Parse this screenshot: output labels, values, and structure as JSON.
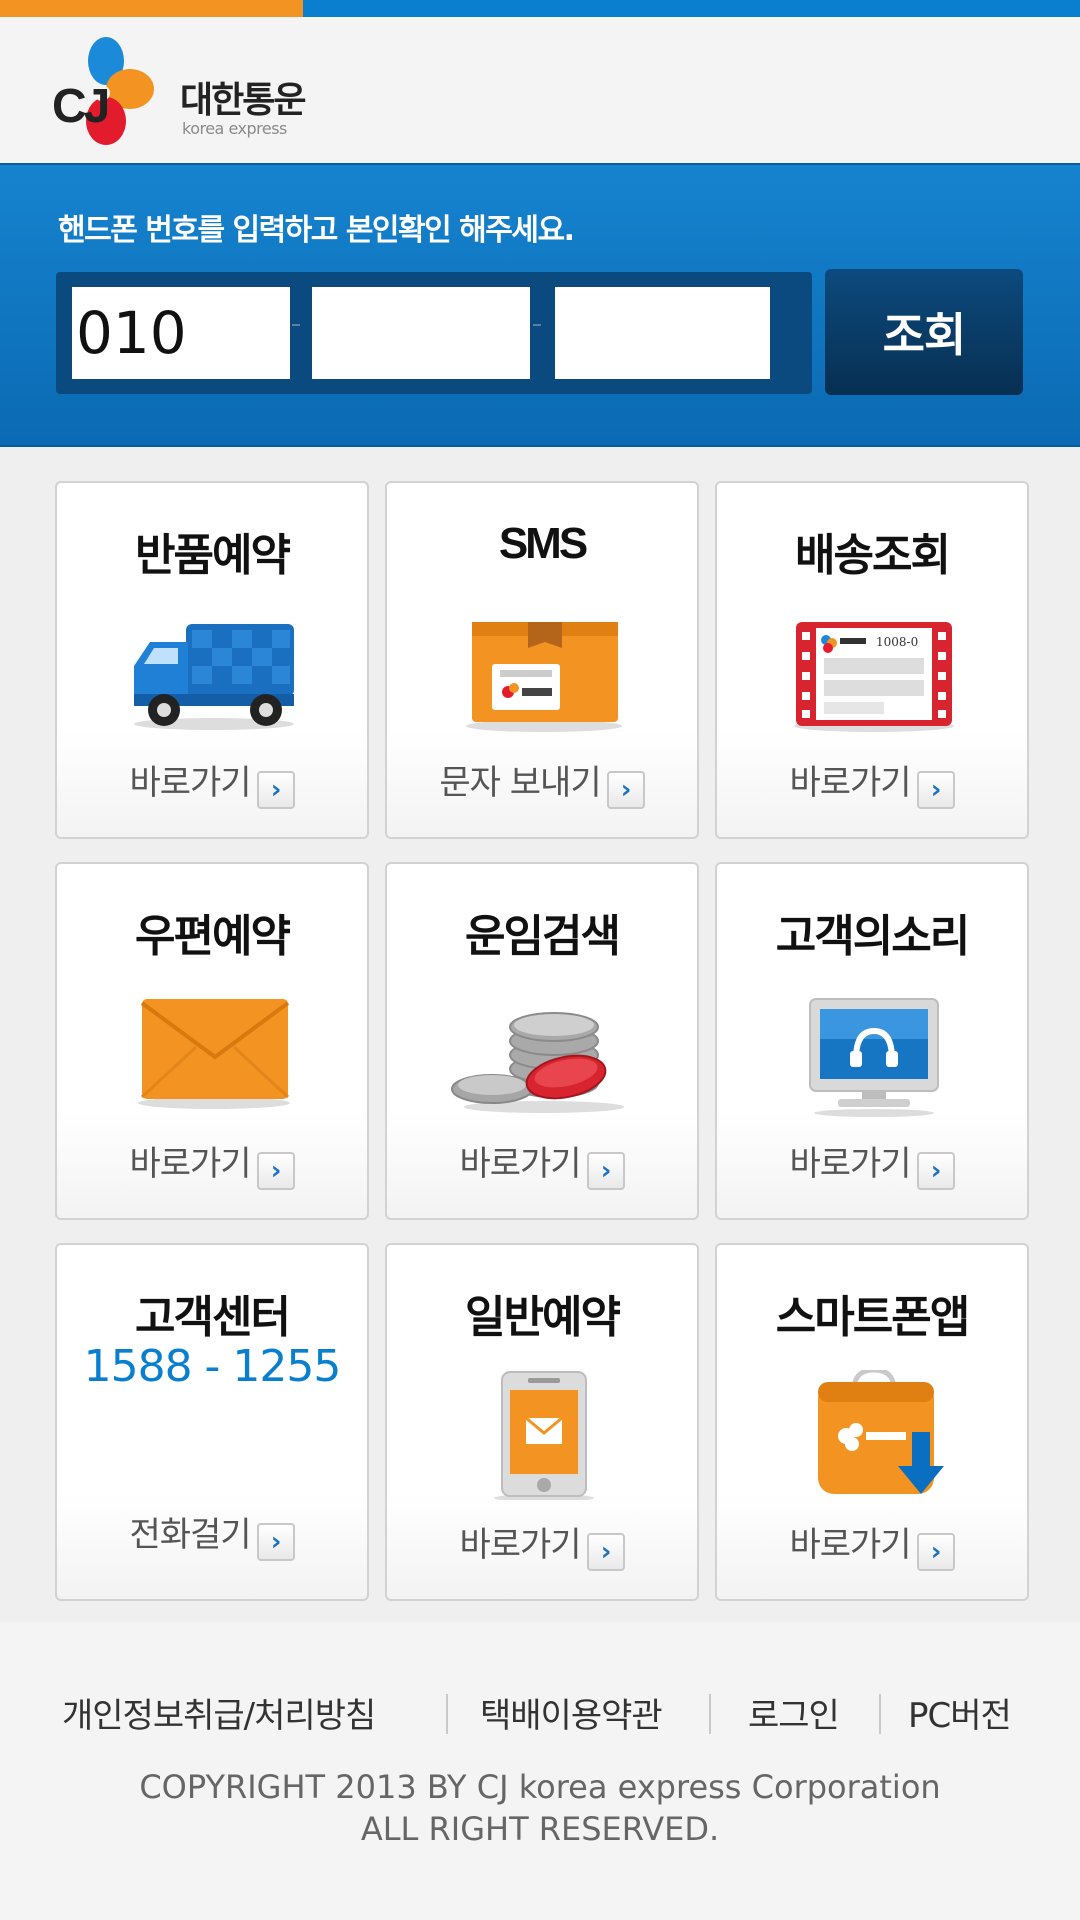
{
  "brand": {
    "logo_mark": "CJ",
    "logo_korean": "대한통운",
    "logo_english": "korea express",
    "colors": {
      "primary_blue": "#0a7fcf",
      "accent_orange": "#f39322",
      "dark_navy": "#082f52"
    }
  },
  "search": {
    "prompt": "핸드폰 번호를 입력하고 본인확인 해주세요.",
    "phone_part1": "010",
    "phone_part2": "",
    "phone_part3": "",
    "submit_label": "조회"
  },
  "tiles": [
    {
      "title": "반품예약",
      "link": "바로가기",
      "icon": "delivery-truck-icon"
    },
    {
      "title": "SMS",
      "link": "문자 보내기",
      "icon": "parcel-box-icon"
    },
    {
      "title": "배송조회",
      "link": "바로가기",
      "icon": "tracking-ticket-icon",
      "ticket_text": "1008-0"
    },
    {
      "title": "우편예약",
      "link": "바로가기",
      "icon": "envelope-icon"
    },
    {
      "title": "운임검색",
      "link": "바로가기",
      "icon": "coins-icon"
    },
    {
      "title": "고객의소리",
      "link": "바로가기",
      "icon": "monitor-headset-icon"
    },
    {
      "title": "고객센터",
      "phone": "1588 - 1255",
      "link": "전화걸기",
      "icon": "phone-call-icon"
    },
    {
      "title": "일반예약",
      "link": "바로가기",
      "icon": "mobile-envelope-icon"
    },
    {
      "title": "스마트폰앱",
      "link": "바로가기",
      "icon": "app-shopping-bag-icon"
    }
  ],
  "arrow_glyph": "›",
  "footer": {
    "links": [
      "개인정보취급/처리방침",
      "택배이용약관",
      "로그인",
      "PC버전"
    ],
    "copyright_line1": "COPYRIGHT 2013 BY CJ korea express Corporation",
    "copyright_line2": "ALL RIGHT RESERVED."
  }
}
